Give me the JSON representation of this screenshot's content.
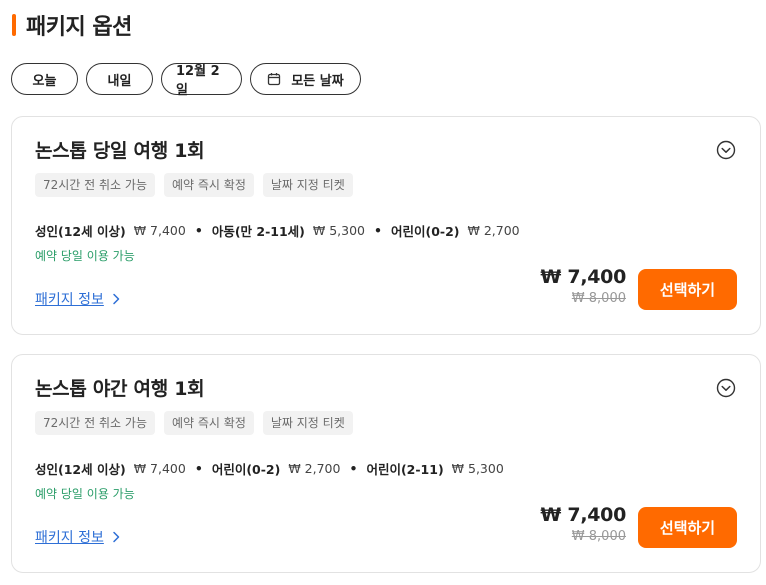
{
  "section": {
    "title": "패키지 옵션"
  },
  "date_filters": [
    {
      "label": "오늘"
    },
    {
      "label": "내일"
    },
    {
      "label": "12월 2일"
    },
    {
      "label": "모든 날짜",
      "icon": "calendar-icon"
    }
  ],
  "packages": [
    {
      "name": "논스톱 당일 여행 1회",
      "tags": [
        "72시간 전 취소 가능",
        "예약 즉시 확정",
        "날짜 지정 티켓"
      ],
      "prices": [
        {
          "label": "성인(12세 이상)",
          "amount": "₩ 7,400"
        },
        {
          "label": "아동(만 2-11세)",
          "amount": "₩ 5,300"
        },
        {
          "label": "어린이(0-2)",
          "amount": "₩ 2,700"
        }
      ],
      "availability": "예약 당일 이용 가능",
      "info_link": "패키지 정보",
      "price_now": "₩ 7,400",
      "price_original": "₩ 8,000",
      "select_label": "선택하기"
    },
    {
      "name": "논스톱 야간 여행 1회",
      "tags": [
        "72시간 전 취소 가능",
        "예약 즉시 확정",
        "날짜 지정 티켓"
      ],
      "prices": [
        {
          "label": "성인(12세 이상)",
          "amount": "₩ 7,400"
        },
        {
          "label": "어린이(0-2)",
          "amount": "₩ 2,700"
        },
        {
          "label": "어린이(2-11)",
          "amount": "₩ 5,300"
        }
      ],
      "availability": "예약 당일 이용 가능",
      "info_link": "패키지 정보",
      "price_now": "₩ 7,400",
      "price_original": "₩ 8,000",
      "select_label": "선택하기"
    }
  ],
  "colors": {
    "accent": "#ff6a00",
    "link": "#2e6fd6",
    "availability": "#2a9d68"
  }
}
